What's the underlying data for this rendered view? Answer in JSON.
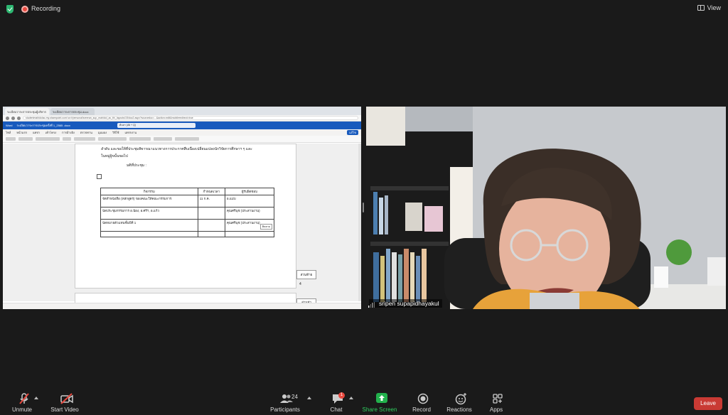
{
  "topbar": {
    "recording_label": "Recording",
    "view_label": "View"
  },
  "shared_screen": {
    "browser_tabs": [
      "ระเบียบวาระการประชุมผู้บริหาร",
      "ระเบียบวาระการประชุม.docx"
    ],
    "url": "studentmahidolac-my.sharepoint.com/:w:/r/personal/sreeran_sup_mahidol_ac_th/_layouts/15/doc2.aspx?sourcedoc=...&action=edit&mobileredirect=true",
    "word_app_label": "Word",
    "doc_title": "ระเบียบวาระการประชุมครั้งที่ 1_2565 .docx",
    "search_placeholder": "ค้นหา (Alt + Q)",
    "menu_items": [
      "ไฟล์",
      "หน้าแรก",
      "แทรก",
      "เค้าโครง",
      "การอ้างอิง",
      "ตรวจทาน",
      "มุมมอง",
      "วิธีใช้",
      "แทรกงาน"
    ],
    "edit_label": "แก้ไข",
    "doc_lines": [
      "ลำดับ และขอให้ที่ประชุมพิจารณาแนวทางการประกาศสืบเนื่องเปลี่ยนแปลงนักวิจัยการศึกษาฯ ๆ และ",
      "ในหมู่ผู้ขนั้นขอไป",
      "มติที่ประชุม :"
    ],
    "table": {
      "headers": [
        "กิจกรรม",
        "กำหนดเวลา",
        "ผู้รับผิดชอบ"
      ],
      "rows": [
        [
          "จัดทำหนังสือ (หลักสูตร) ของคณะให้คณะกรรมการ",
          "11 ก.ค.",
          "อ.แม่บ"
        ],
        [
          "นัดประชุมกรรมการ อ.น้อง, อ.ศรีฯ, อ.แก้ว",
          "",
          "คุณศรีนุช (ประสานงาน)"
        ],
        [
          "นัดหมายตัวแทนชั้นปีที่ 1",
          "",
          "คุณศรีนุช (ประสานงาน)"
        ],
        [
          "",
          "",
          ""
        ]
      ],
      "cell_tag": "ติดตาม"
    },
    "side_note_1": "ส่วนท้าย",
    "side_note_1_number": "4",
    "side_note_2": "ส่วนหัว"
  },
  "video": {
    "participant_name": "sripen supapidhayakul"
  },
  "toolbar": {
    "unmute": "Unmute",
    "start_video": "Start Video",
    "participants": "Participants",
    "participants_count": "24",
    "chat": "Chat",
    "chat_badge": "1",
    "share_screen": "Share Screen",
    "record": "Record",
    "reactions": "Reactions",
    "apps": "Apps",
    "leave": "Leave"
  },
  "colors": {
    "background": "#1a1a1a",
    "share_green": "#22b14c",
    "leave_red": "#c93a34",
    "recording_red": "#e8493f",
    "word_blue": "#185abd"
  }
}
